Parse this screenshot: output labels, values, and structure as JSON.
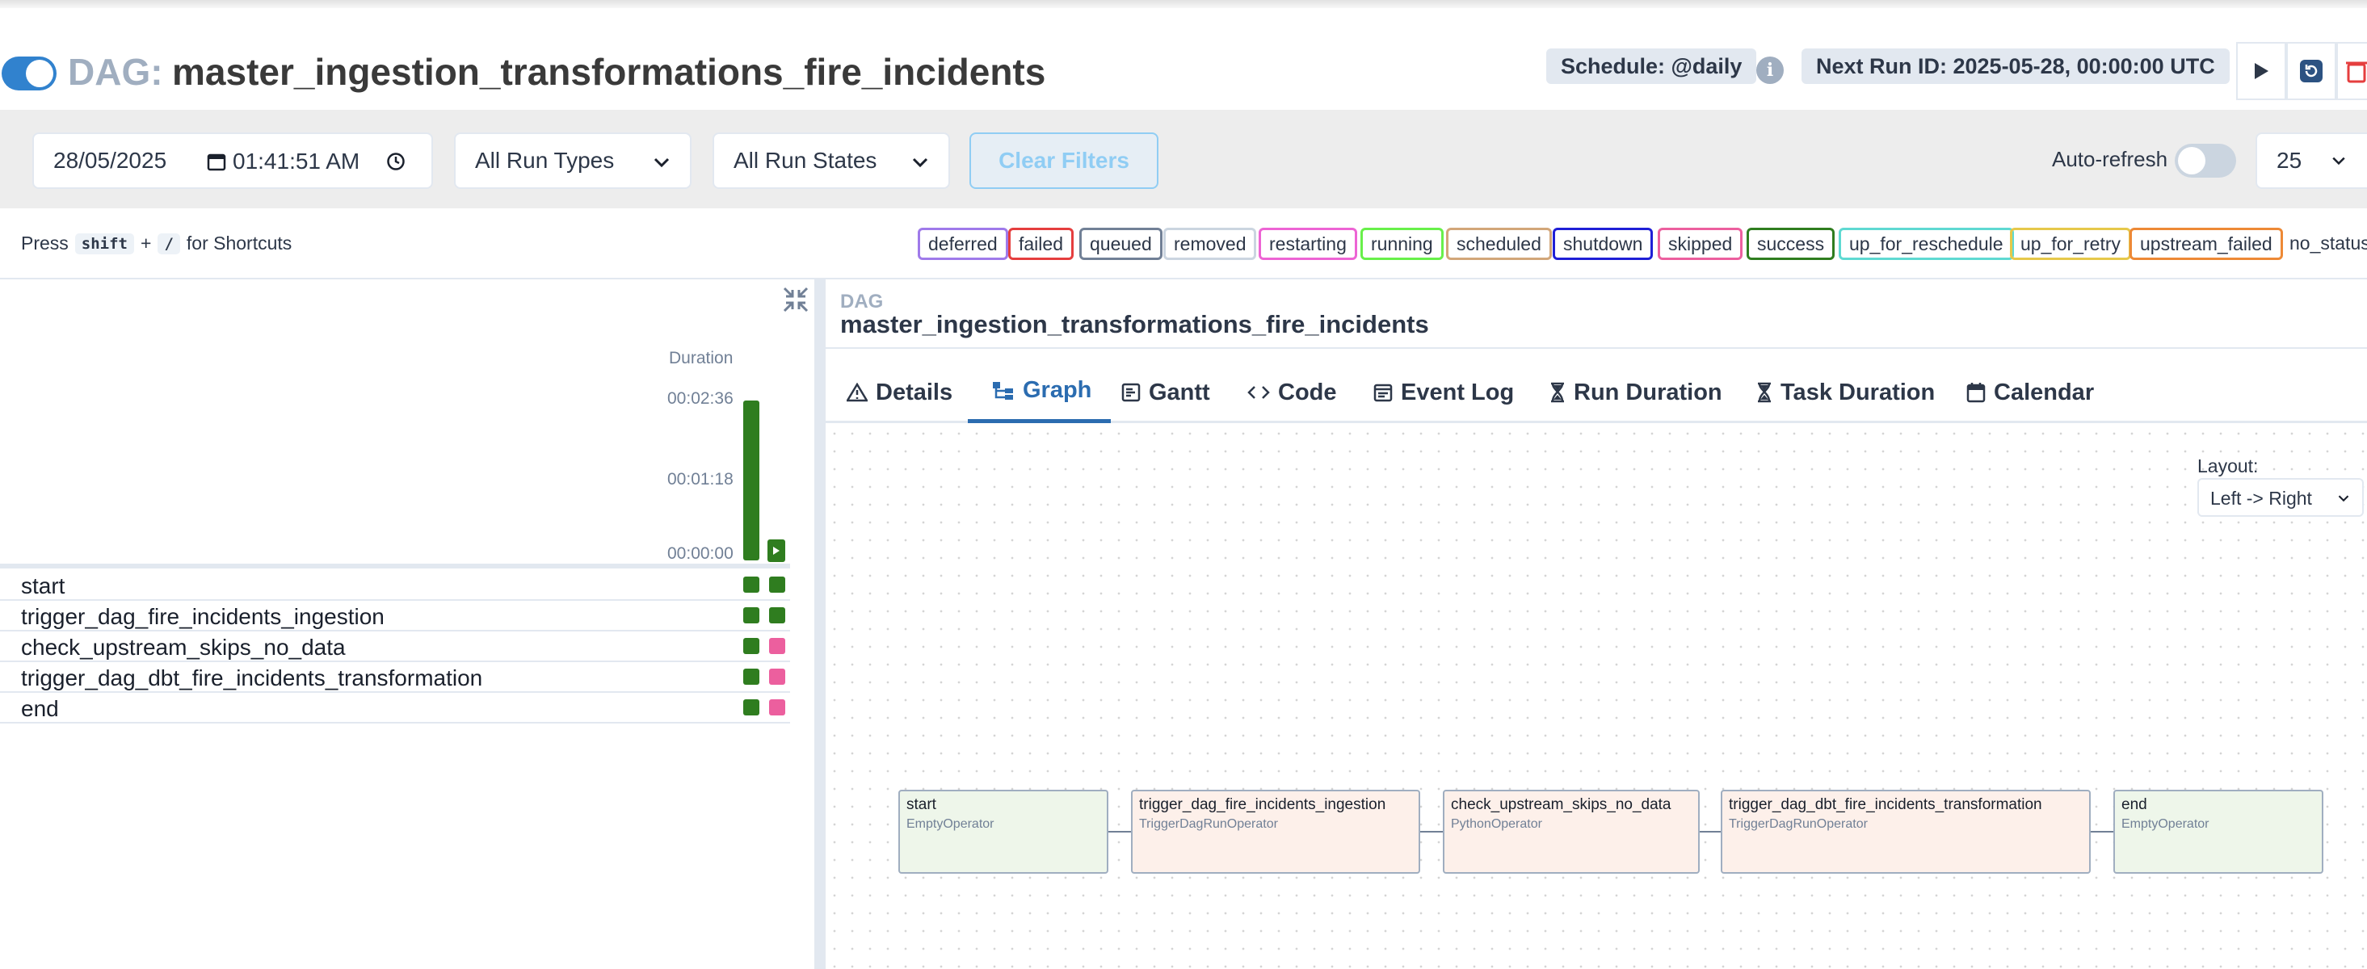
{
  "header": {
    "dag_prefix": "DAG:",
    "dag_id": "master_ingestion_transformations_fire_incidents",
    "schedule": "Schedule: @daily",
    "info_glyph": "i",
    "next_run": "Next Run ID: 2025-05-28, 00:00:00 UTC",
    "buttons": [
      "play-icon",
      "reparse-icon",
      "delete-icon"
    ]
  },
  "filters": {
    "date": "28/05/2025",
    "time": "01:41:51 AM",
    "run_types": "All Run Types",
    "run_states": "All Run States",
    "clear": "Clear Filters",
    "auto_refresh": "Auto-refresh",
    "page_size": "25"
  },
  "shortcuts": {
    "press": "Press",
    "key1": "shift",
    "plus": "+",
    "key2": "/",
    "suffix": "for Shortcuts"
  },
  "legend": {
    "states": [
      {
        "label": "deferred",
        "color": "#9f7aea"
      },
      {
        "label": "failed",
        "color": "#e53e3e"
      },
      {
        "label": "queued",
        "color": "#718096"
      },
      {
        "label": "removed",
        "color": "#cbd5e0"
      },
      {
        "label": "restarting",
        "color": "#ed64d4"
      },
      {
        "label": "running",
        "color": "#68f04a"
      },
      {
        "label": "scheduled",
        "color": "#d2a679"
      },
      {
        "label": "shutdown",
        "color": "#1f1fd6"
      },
      {
        "label": "skipped",
        "color": "#ec5f9e"
      },
      {
        "label": "success",
        "color": "#2f7d1f"
      },
      {
        "label": "up_for_reschedule",
        "color": "#5fd9d2"
      },
      {
        "label": "up_for_retry",
        "color": "#e6c84a"
      },
      {
        "label": "upstream_failed",
        "color": "#ed8936"
      }
    ],
    "no_status": "no_status"
  },
  "grid": {
    "duration_label": "Duration",
    "ticks": [
      "00:02:36",
      "00:01:18",
      "00:00:00"
    ],
    "run_duration_fraction": 1.0,
    "tasks": [
      {
        "name": "start",
        "states": [
          "success",
          "success"
        ]
      },
      {
        "name": "trigger_dag_fire_incidents_ingestion",
        "states": [
          "success",
          "success"
        ]
      },
      {
        "name": "check_upstream_skips_no_data",
        "states": [
          "success",
          "skipped"
        ]
      },
      {
        "name": "trigger_dag_dbt_fire_incidents_transformation",
        "states": [
          "success",
          "skipped"
        ]
      },
      {
        "name": "end",
        "states": [
          "success",
          "skipped"
        ]
      }
    ]
  },
  "detail": {
    "dag_small": "DAG",
    "dag_name": "master_ingestion_transformations_fire_incidents",
    "tabs": [
      {
        "label": "Details",
        "icon": "warning-icon"
      },
      {
        "label": "Graph",
        "icon": "graph-icon"
      },
      {
        "label": "Gantt",
        "icon": "gantt-icon"
      },
      {
        "label": "Code",
        "icon": "code-icon"
      },
      {
        "label": "Event Log",
        "icon": "event-log-icon"
      },
      {
        "label": "Run Duration",
        "icon": "hourglass-icon"
      },
      {
        "label": "Task Duration",
        "icon": "hourglass-icon"
      },
      {
        "label": "Calendar",
        "icon": "calendar-icon"
      }
    ],
    "active_tab": "Graph",
    "layout_label": "Layout:",
    "layout_value": "Left -> Right"
  },
  "graph": {
    "nodes": [
      {
        "name": "start",
        "operator": "EmptyOperator",
        "color": "#eef6ea"
      },
      {
        "name": "trigger_dag_fire_incidents_ingestion",
        "operator": "TriggerDagRunOperator",
        "color": "#fdf0ea"
      },
      {
        "name": "check_upstream_skips_no_data",
        "operator": "PythonOperator",
        "color": "#fdf0ea"
      },
      {
        "name": "trigger_dag_dbt_fire_incidents_transformation",
        "operator": "TriggerDagRunOperator",
        "color": "#fdf0ea"
      },
      {
        "name": "end",
        "operator": "EmptyOperator",
        "color": "#eef6ea"
      }
    ]
  }
}
